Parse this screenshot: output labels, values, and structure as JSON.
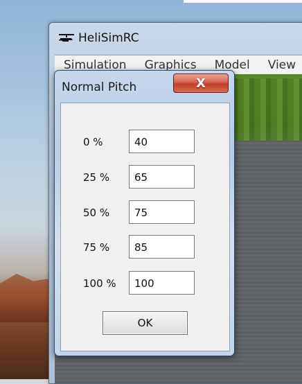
{
  "app": {
    "title": "HeliSimRC",
    "menu": [
      "Simulation",
      "Graphics",
      "Model",
      "View"
    ]
  },
  "dialog": {
    "title": "Normal Pitch",
    "close_glyph": "X",
    "rows": [
      {
        "label": "0 %",
        "value": "40"
      },
      {
        "label": "25 %",
        "value": "65"
      },
      {
        "label": "50 %",
        "value": "75"
      },
      {
        "label": "75 %",
        "value": "85"
      },
      {
        "label": "100 %",
        "value": "100"
      }
    ],
    "ok_label": "OK"
  }
}
